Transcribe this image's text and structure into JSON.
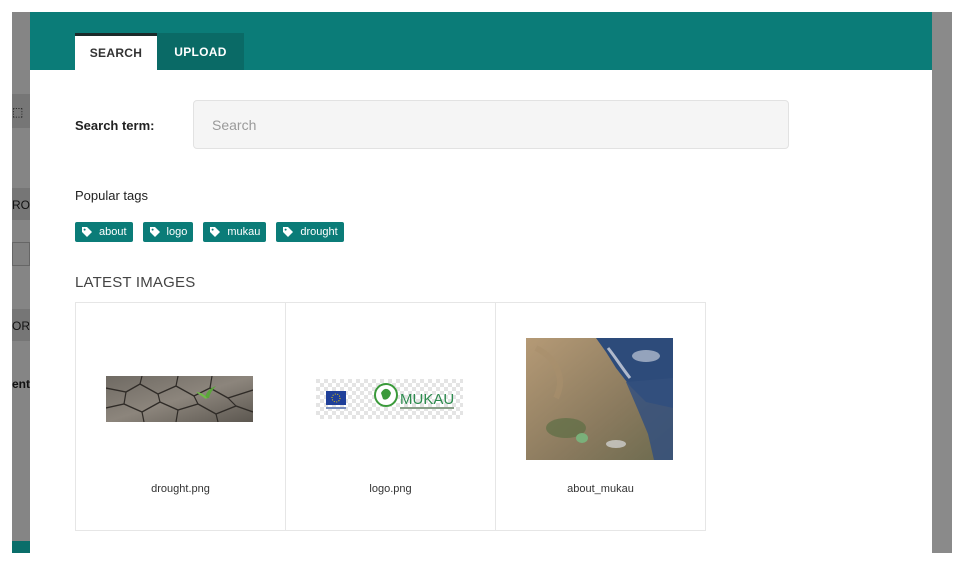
{
  "background": {
    "fragments": [
      "⬚",
      "RO",
      "ORI",
      "ent"
    ]
  },
  "modal": {
    "tabs": [
      {
        "label": "SEARCH",
        "active": true
      },
      {
        "label": "UPLOAD",
        "active": false
      }
    ],
    "search": {
      "label": "Search term:",
      "placeholder": "Search",
      "value": ""
    },
    "popular_tags": {
      "title": "Popular tags",
      "tags": [
        "about",
        "logo",
        "mukau",
        "drought"
      ]
    },
    "latest_images": {
      "title": "LATEST IMAGES",
      "items": [
        {
          "filename": "drought.png"
        },
        {
          "filename": "logo.png",
          "logo_text": "MUKAU"
        },
        {
          "filename": "about_mukau"
        }
      ]
    }
  },
  "colors": {
    "header_teal": "#0b7c78",
    "tab_dark": "#0a6a66",
    "tag_bg": "#0b7c78"
  }
}
